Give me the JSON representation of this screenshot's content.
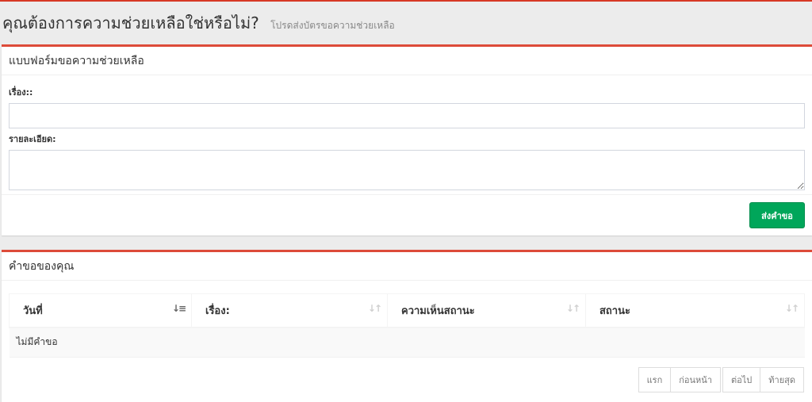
{
  "header": {
    "title": "คุณต้องการความช่วยเหลือใช่หรือไม่?",
    "subtitle": "โปรดส่งบัตรขอความช่วยเหลือ"
  },
  "form": {
    "title": "แบบฟอร์มขอความช่วยเหลือ",
    "subject_label": "เรื่อง::",
    "subject_value": "",
    "details_label": "รายละเอียด:",
    "details_value": "",
    "submit_label": "ส่งคำขอ"
  },
  "requests": {
    "title": "คำขอของคุณ",
    "columns": [
      "วันที่",
      "เรื่อง:",
      "ความเห็นสถานะ",
      "สถานะ"
    ],
    "sorted_column": 0,
    "empty_text": "ไม่มีคำขอ"
  },
  "pagination": {
    "first": "แรก",
    "previous": "ก่อนหน้า",
    "next": "ต่อไป",
    "last": "ท้ายสุด"
  },
  "colors": {
    "accent": "#dd4b39",
    "success": "#00a65a"
  },
  "icons": {
    "sort": "sort-icon",
    "sort_active": "sort-descending-icon"
  }
}
